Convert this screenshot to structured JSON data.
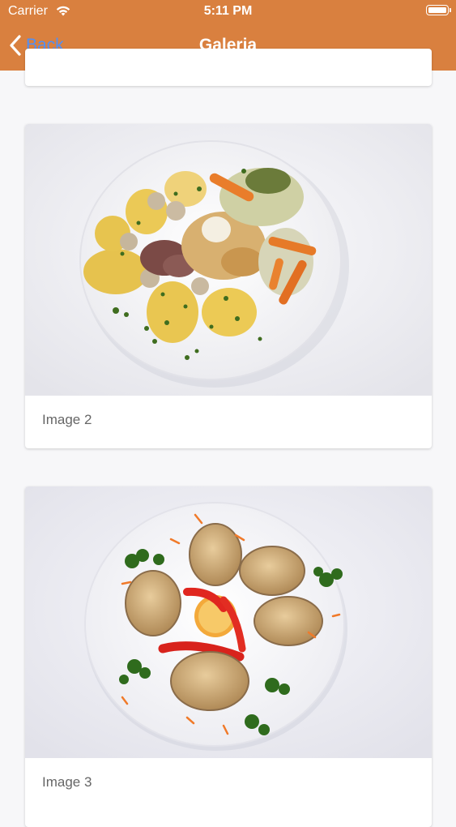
{
  "status_bar": {
    "carrier": "Carrier",
    "time": "5:11 PM"
  },
  "nav": {
    "back_label": "Back",
    "title": "Galeria"
  },
  "gallery": [
    {
      "caption": "Image 2"
    },
    {
      "caption": "Image 3"
    }
  ],
  "colors": {
    "nav_bg": "#d9803f",
    "back_link": "#4f8ff7"
  }
}
